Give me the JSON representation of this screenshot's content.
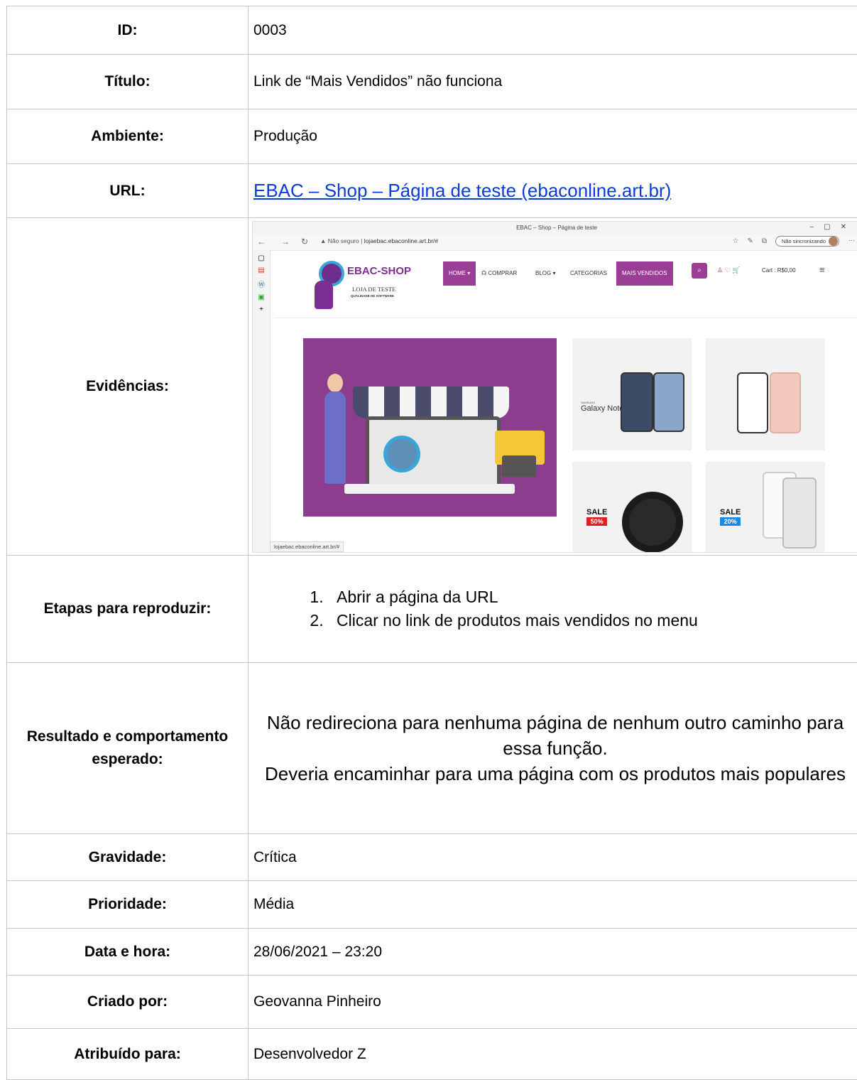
{
  "rows": {
    "id": {
      "label": "ID:",
      "value": "0003"
    },
    "titulo": {
      "label": "Título:",
      "value": "Link de “Mais Vendidos” não funciona"
    },
    "ambiente": {
      "label": "Ambiente:",
      "value": "Produção"
    },
    "url": {
      "label": "URL:",
      "value": "EBAC – Shop – Página de teste (ebaconline.art.br)"
    },
    "evidencias": {
      "label": "Evidências:"
    },
    "etapas": {
      "label": "Etapas para reproduzir:",
      "steps": [
        "Abrir a página da URL",
        "Clicar no link de produtos mais vendidos no menu"
      ]
    },
    "resultado": {
      "label": "Resultado e comportamento esperado:",
      "line1": "Não redireciona para nenhuma página de nenhum outro caminho para essa função.",
      "line2": "Deveria encaminhar para uma página com os produtos mais populares"
    },
    "gravidade": {
      "label": "Gravidade:",
      "value": "Crítica"
    },
    "prioridade": {
      "label": "Prioridade:",
      "value": "Média"
    },
    "data": {
      "label": "Data e hora:",
      "value": "28/06/2021 – 23:20"
    },
    "criado": {
      "label": "Criado por:",
      "value": "Geovanna Pinheiro"
    },
    "atribuido": {
      "label": "Atribuído para:",
      "value": "Desenvolvedor Z"
    }
  },
  "screenshot": {
    "window_title": "EBAC – Shop – Página de teste",
    "not_secure": "Não seguro",
    "address": "lojaebac.ebaconline.art.br/#",
    "sync_label": "Não sincronizando",
    "brand": "EBAC-SHOP",
    "tagline": "LOJA DE TESTE",
    "tagline_sub": "QUALIDADE DE SOFTWARE",
    "menu": {
      "home": "HOME ▾",
      "comprar": "COMPRAR",
      "blog": "BLOG ▾",
      "categorias": "CATEGORIAS",
      "mais_vendidos": "MAIS VENDIDOS"
    },
    "cart": "Cart : R$0,00",
    "galaxy_brand": "SAMSUNG",
    "galaxy_name": "Galaxy Note7",
    "sale1": "SALE",
    "sale1_pct": "50%",
    "sale2": "SALE",
    "sale2_pct": "20%",
    "status_url": "lojaebac.ebaconline.art.br/#",
    "colors": {
      "brand_purple": "#9a3d95",
      "banner_purple": "#8c3d8d",
      "sale_red": "#e02020",
      "sale_blue": "#1e88e5"
    }
  }
}
